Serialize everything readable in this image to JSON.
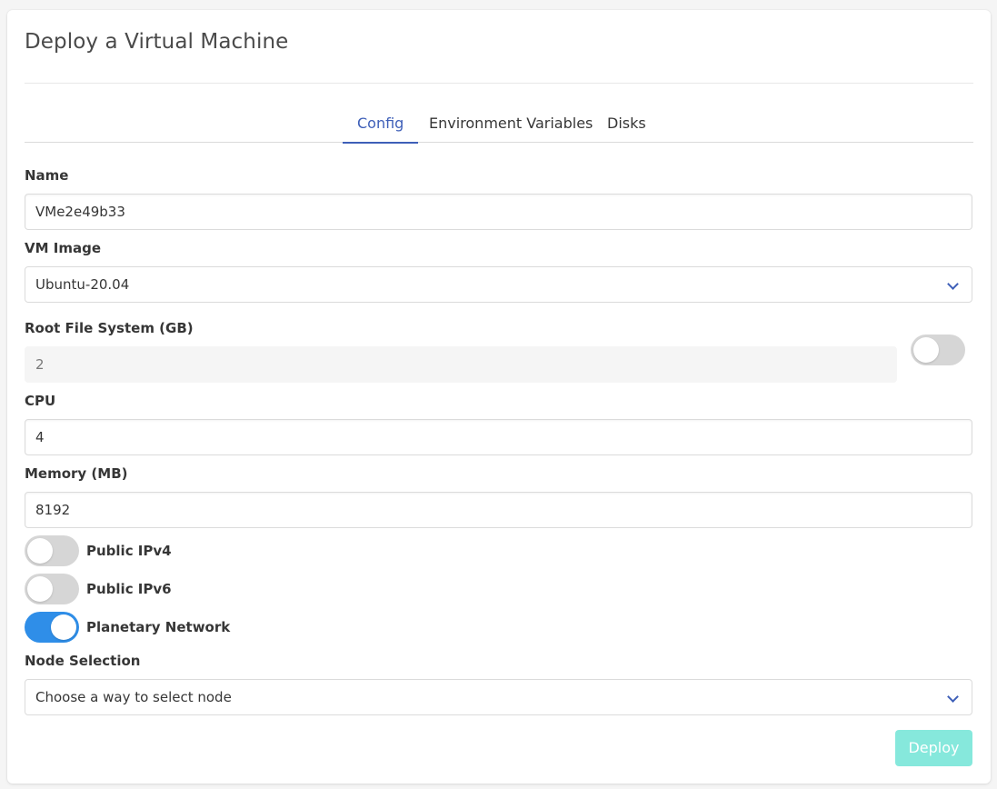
{
  "page": {
    "title": "Deploy a Virtual Machine"
  },
  "tabs": [
    {
      "label": "Config",
      "active": true
    },
    {
      "label": "Environment Variables",
      "active": false
    },
    {
      "label": "Disks",
      "active": false
    }
  ],
  "form": {
    "name": {
      "label": "Name",
      "value": "VMe2e49b33"
    },
    "vm_image": {
      "label": "VM Image",
      "value": "Ubuntu-20.04"
    },
    "root_fs": {
      "label": "Root File System (GB)",
      "value": "2",
      "disabled": true,
      "custom_toggle_on": false
    },
    "cpu": {
      "label": "CPU",
      "value": "4"
    },
    "memory": {
      "label": "Memory (MB)",
      "value": "8192"
    },
    "public_ipv4": {
      "label": "Public IPv4",
      "on": false
    },
    "public_ipv6": {
      "label": "Public IPv6",
      "on": false
    },
    "planetary": {
      "label": "Planetary Network",
      "on": true
    },
    "node_selection": {
      "label": "Node Selection",
      "value": "Choose a way to select node"
    }
  },
  "actions": {
    "deploy_label": "Deploy",
    "deploy_disabled": true
  },
  "colors": {
    "accent": "#3e5fb8",
    "toggle_on": "#2f8ee8",
    "toggle_off": "#d6d6d6",
    "deploy_disabled": "#86e8dc"
  },
  "icons": {
    "select_arrow": "chevron-down-icon"
  }
}
